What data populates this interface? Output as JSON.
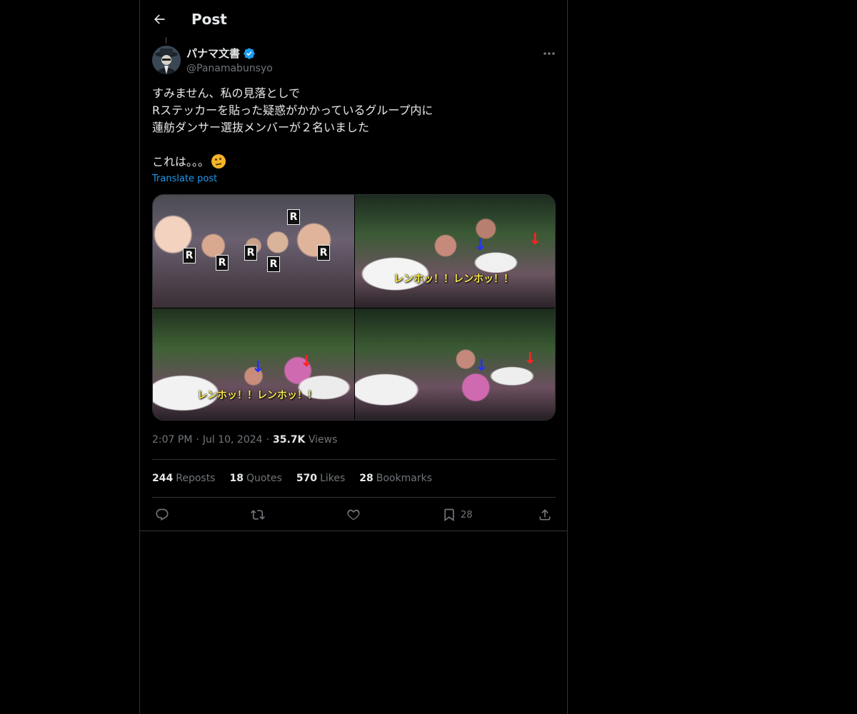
{
  "header": {
    "title": "Post"
  },
  "author": {
    "name": "パナマ文書",
    "handle": "@Panamabunsyo"
  },
  "post": {
    "lines": [
      "すみません、私の見落としで",
      "Rステッカーを貼った疑惑がかかっているグループ内に",
      "蓮舫ダンサー選抜メンバーが２名いました",
      "",
      "これは。。。"
    ],
    "translate_label": "Translate post"
  },
  "media": {
    "captions": [
      "レンホッ！！レンホッ！！",
      "レンホッ！！レンホッ！！"
    ],
    "card_letter": "R"
  },
  "meta": {
    "time": "2:07 PM",
    "date": "Jul 10, 2024",
    "views_count": "35.7K",
    "views_label": "Views"
  },
  "stats": {
    "reposts": {
      "count": "244",
      "label": "Reposts"
    },
    "quotes": {
      "count": "18",
      "label": "Quotes"
    },
    "likes": {
      "count": "570",
      "label": "Likes"
    },
    "bookmarks": {
      "count": "28",
      "label": "Bookmarks"
    }
  },
  "actions": {
    "bookmark_count": "28"
  },
  "colors": {
    "accent": "#1d9bf0",
    "muted": "#71767b",
    "text": "#e7e9ea",
    "border": "#2f3336"
  },
  "icons": [
    "back-arrow-icon",
    "verified-badge-icon",
    "more-icon",
    "reply-icon",
    "repost-icon",
    "like-icon",
    "bookmark-icon",
    "share-icon",
    "thinking-face-emoji"
  ]
}
